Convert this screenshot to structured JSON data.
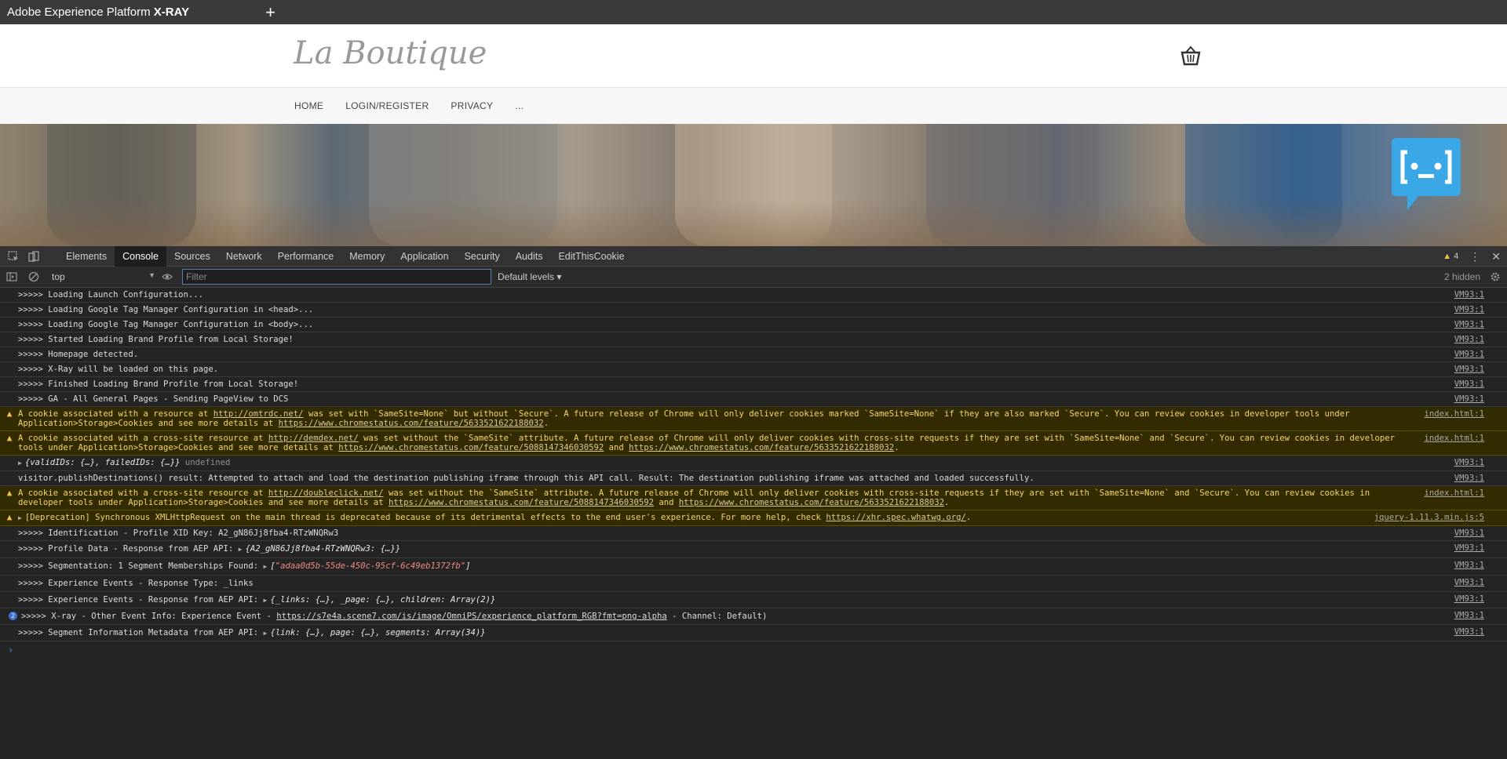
{
  "app": {
    "title_prefix": "Adobe Experience Platform ",
    "title_bold": "X-RAY",
    "new_tab": "+"
  },
  "site": {
    "logo": "La Boutique",
    "nav": [
      "HOME",
      "LOGIN/REGISTER",
      "PRIVACY",
      "..."
    ]
  },
  "devtools": {
    "tabs": [
      "Elements",
      "Console",
      "Sources",
      "Network",
      "Performance",
      "Memory",
      "Application",
      "Security",
      "Audits",
      "EditThisCookie"
    ],
    "active_tab": "Console",
    "warning_count": "4",
    "context": "top",
    "filter_placeholder": "Filter",
    "levels": "Default levels ▾",
    "hidden": "2 hidden"
  },
  "console": {
    "lines": [
      {
        "text": ">>>>> Loading Launch Configuration...",
        "src": "VM93:1"
      },
      {
        "text": ">>>>> Loading Google Tag Manager Configuration in <head>...",
        "src": "VM93:1"
      },
      {
        "text": ">>>>> Loading Google Tag Manager Configuration in <body>...",
        "src": "VM93:1"
      },
      {
        "text": ">>>>> Started Loading Brand Profile from Local Storage!",
        "src": "VM93:1"
      },
      {
        "text": ">>>>> Homepage detected.",
        "src": "VM93:1"
      },
      {
        "text": ">>>>> X-Ray will be loaded on this page.",
        "src": "VM93:1"
      },
      {
        "text": ">>>>> Finished Loading Brand Profile from Local Storage!",
        "src": "VM93:1"
      },
      {
        "text": ">>>>> GA - All General Pages - Sending PageView to DCS",
        "src": "VM93:1"
      }
    ],
    "warn1": {
      "a": "A cookie associated with a resource at ",
      "link1": "http://omtrdc.net/",
      "b": " was set with `SameSite=None` but without `Secure`. A future release of Chrome will only deliver cookies marked `SameSite=None` if they are also marked `Secure`. You can review cookies in developer tools under Application>Storage>Cookies and see more details at ",
      "link2": "https://www.chromestatus.com/feature/5633521622188032",
      "c": ".",
      "src": "index.html:1"
    },
    "warn2": {
      "a": "A cookie associated with a cross-site resource at ",
      "link1": "http://demdex.net/",
      "b": " was set without the `SameSite` attribute. A future release of Chrome will only deliver cookies with cross-site requests if they are set with `SameSite=None` and `Secure`. You can review cookies in developer tools under Application>Storage>Cookies and see more details at ",
      "link2": "https://www.chromestatus.com/feature/5088147346030592",
      "and": " and ",
      "link3": "https://www.chromestatus.com/feature/5633521622188032",
      "c": ".",
      "src": "index.html:1"
    },
    "obj_line": {
      "text": "{validIDs: {…}, failedIDs: {…}}",
      "undef": " undefined",
      "src": "VM93:1"
    },
    "publish_line": {
      "text": "visitor.publishDestinations() result: Attempted to attach and load the destination publishing iframe through this API call. Result: The destination publishing iframe was attached and loaded successfully.",
      "src": "VM93:1"
    },
    "warn3": {
      "a": "A cookie associated with a cross-site resource at ",
      "link1": "http://doubleclick.net/",
      "b": " was set without the `SameSite` attribute. A future release of Chrome will only deliver cookies with cross-site requests if they are set with `SameSite=None` and `Secure`. You can review cookies in developer tools under Application>Storage>Cookies and see more details at ",
      "link2": "https://www.chromestatus.com/feature/5088147346030592",
      "and": " and ",
      "link3": "https://www.chromestatus.com/feature/5633521622188032",
      "c": ".",
      "src": "index.html:1"
    },
    "warn4": {
      "a": "[Deprecation] Synchronous XMLHttpRequest on the main thread is deprecated because of its detrimental effects to the end user's experience. For more help, check ",
      "link1": "https://xhr.spec.whatwg.org/",
      "c": ".",
      "src": "jquery-1.11.3.min.js:5"
    },
    "xid": {
      "text": ">>>>> Identification - Profile XID Key: A2_gN86Jj8fba4-RTzWNQRw3",
      "src": "VM93:1"
    },
    "profile": {
      "text": ">>>>> Profile Data - Response from AEP API: ",
      "obj": "{A2_gN86Jj8fba4-RTzWNQRw3: {…}}",
      "src": "VM93:1"
    },
    "seg": {
      "text": ">>>>> Segmentation: 1 Segment Memberships Found: ",
      "open": "[",
      "str": "\"adaa0d5b-55de-450c-95cf-6c49eb1372fb\"",
      "close": "]",
      "src": "VM93:1"
    },
    "evtype": {
      "text": ">>>>> Experience Events - Response Type: _links",
      "src": "VM93:1"
    },
    "evresp": {
      "text": ">>>>> Experience Events - Response from AEP API: ",
      "obj": "{_links: {…}, _page: {…}, children: Array(2)}",
      "src": "VM93:1"
    },
    "xray": {
      "badge": "2",
      "text": ">>>>> X-ray - Other Event Info: Experience Event - ",
      "link": "https://s7e4a.scene7.com/is/image/OmniPS/experience_platform_RGB?fmt=png-alpha",
      "tail": " - Channel: Default)",
      "src": "VM93:1"
    },
    "segmeta": {
      "text": ">>>>> Segment Information Metadata from AEP API: ",
      "obj": "{link: {…}, page: {…}, segments: Array(34)}",
      "src": "VM93:1"
    },
    "prompt": "›"
  }
}
